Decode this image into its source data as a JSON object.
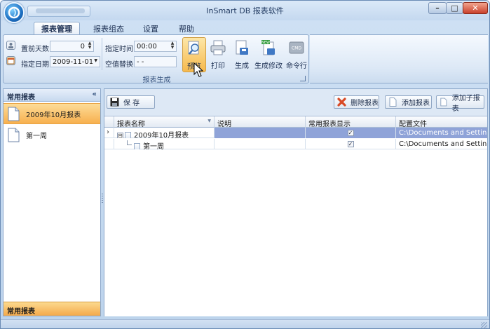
{
  "window": {
    "title": "InSmart DB 报表软件",
    "logo_glyph": "",
    "minimize": "–",
    "maximize": "□",
    "close": "✕"
  },
  "ribbon": {
    "tabs": [
      "报表管理",
      "报表组态",
      "设置",
      "帮助"
    ],
    "fields": {
      "days_before_label": "置前天数",
      "days_before_value": "0",
      "date_label": "指定日期",
      "date_value": "2009-11-01",
      "time_label": "指定时间",
      "time_value": "00:00",
      "null_replace_label": "空值替换",
      "null_replace_value": "- -"
    },
    "buttons": {
      "preview": "预览",
      "print": "打印",
      "generate": "生成",
      "generate_modify": "生成修改",
      "cmdline": "命令行",
      "cmd_badge": "CMD",
      "new_badge": "NEW"
    },
    "group_label": "报表生成"
  },
  "left_panel": {
    "header": "常用报表",
    "collapse_glyph": "«",
    "items": [
      "2009年10月报表",
      "第一周"
    ],
    "bottom_label": "常用报表"
  },
  "toolbar": {
    "save": "保 存",
    "delete": "删除报表",
    "add": "添加报表",
    "add_sub": "添加子报表"
  },
  "grid": {
    "columns": [
      "报表名称",
      "说明",
      "常用报表显示",
      "配置文件"
    ],
    "rows": [
      {
        "name": "2009年10月报表",
        "desc": "",
        "checked": "✓",
        "config": "C:\\Documents and Setting..."
      },
      {
        "name": "第一周",
        "desc": "",
        "checked": "✓",
        "config": "C:\\Documents and Setting..."
      }
    ],
    "row_indicator": "›",
    "tree_toggle": "⊟"
  },
  "colors": {
    "selected_item": "#f7b04e",
    "selected_row": "#8fa3d8",
    "close_button": "#c9402b"
  }
}
